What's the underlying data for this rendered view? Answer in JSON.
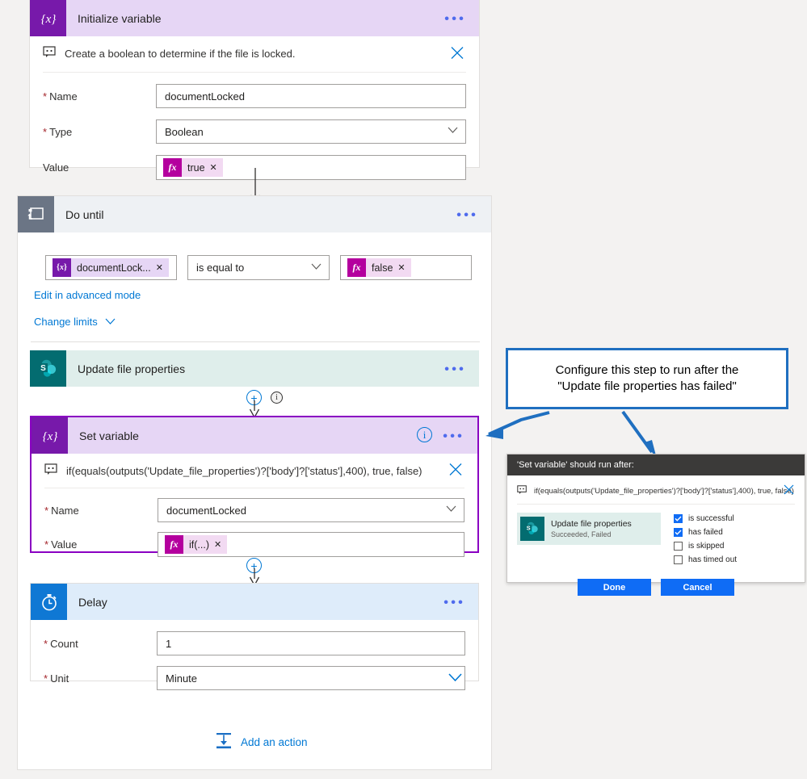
{
  "colors": {
    "variable_purple": "#7719aa",
    "variable_header": "#e6d6f5",
    "loop_gray": "#6b7585",
    "loop_header": "#eef1f4",
    "sharepoint_teal": "#036c70",
    "sharepoint_header": "#dfeeeb",
    "delay_blue": "#0f78d4",
    "delay_header": "#deecfa",
    "accent_blue": "#0078d4",
    "button_blue": "#0f6cf5",
    "callout_border": "#1f6fc0",
    "selected_outline": "#8a00c2",
    "fx_magenta": "#b4009e",
    "required_red": "#a4262c"
  },
  "initialize_variable": {
    "title": "Initialize variable",
    "icon": "variable-icon",
    "note": "Create a boolean to determine if the file is locked.",
    "fields": [
      {
        "label": "Name",
        "required": true,
        "value": "documentLocked",
        "type": "text"
      },
      {
        "label": "Type",
        "required": true,
        "value": "Boolean",
        "type": "dropdown"
      }
    ],
    "value_field": {
      "label": "Value",
      "required": false,
      "token_kind": "fx",
      "token_text": "true"
    }
  },
  "do_until": {
    "title": "Do until",
    "icon": "loop-icon",
    "condition": {
      "left_token": "documentLock...",
      "left_token_kind": "variable",
      "operator": "is equal to",
      "right_token": "false",
      "right_token_kind": "fx"
    },
    "advanced_link": "Edit in advanced mode",
    "limits_link": "Change limits"
  },
  "update_file_properties": {
    "title": "Update file properties",
    "icon": "sharepoint-icon"
  },
  "set_variable": {
    "title": "Set variable",
    "icon": "variable-icon",
    "note": "if(equals(outputs('Update_file_properties')?['body']?['status'],400), true, false)",
    "fields": [
      {
        "label": "Name",
        "required": true,
        "value": "documentLocked",
        "type": "dropdown"
      }
    ],
    "value_field": {
      "label": "Value",
      "required": true,
      "token_kind": "fx",
      "token_text": "if(...)"
    }
  },
  "delay": {
    "title": "Delay",
    "icon": "stopwatch-icon",
    "fields": [
      {
        "label": "Count",
        "required": true,
        "value": "1",
        "type": "text"
      },
      {
        "label": "Unit",
        "required": true,
        "value": "Minute",
        "type": "dropdown"
      }
    ]
  },
  "add_action": {
    "label": "Add an action",
    "icon": "add-action-icon"
  },
  "callout": {
    "line1": "Configure this step to run after the",
    "line2": "\"Update file properties has failed\""
  },
  "run_after_dialog": {
    "header": "'Set variable' should run after:",
    "note": "if(equals(outputs('Update_file_properties')?['body']?['status'],400), true, false)",
    "dependency": {
      "title": "Update file properties",
      "status": "Succeeded, Failed",
      "icon": "sharepoint-icon"
    },
    "checkboxes": [
      {
        "label": "is successful",
        "checked": true
      },
      {
        "label": "has failed",
        "checked": true
      },
      {
        "label": "is skipped",
        "checked": false
      },
      {
        "label": "has timed out",
        "checked": false
      }
    ],
    "done_label": "Done",
    "cancel_label": "Cancel"
  }
}
